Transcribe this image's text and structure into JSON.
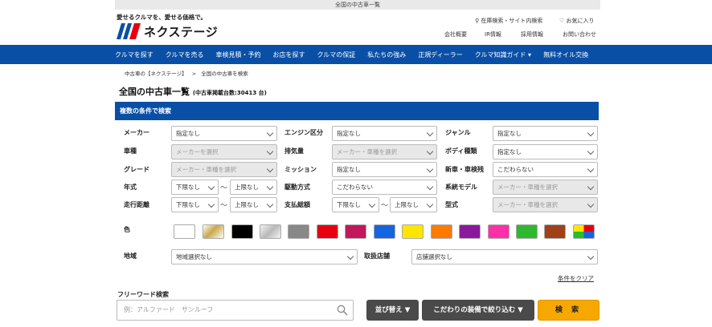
{
  "topbar": {
    "text": "全国の中古車一覧"
  },
  "header": {
    "tagline": "愛せるクルマを、愛せる価格で。",
    "logo_text": "ネクステージ",
    "links_top": [
      "在庫検索・サイト内検索",
      "お気に入り"
    ],
    "links_bottom": [
      "会社概要",
      "IR情報",
      "採用情報",
      "お問い合わせ"
    ]
  },
  "nav": {
    "items": [
      "クルマを探す",
      "クルマを売る",
      "車検見積・予約",
      "お店を探す",
      "クルマの保証",
      "私たちの強み",
      "正規ディーラー",
      "クルマ知識ガイド ▾",
      "無料オイル交換"
    ]
  },
  "breadcrumb": {
    "home": "中古車の【ネクステージ】",
    "sep": ">",
    "current": "全国の中古車を検索"
  },
  "page": {
    "title": "全国の中古車一覧",
    "count": "(中古車掲載台数:30413 台)"
  },
  "search": {
    "section_title": "複数の条件で検索",
    "fields": {
      "maker": {
        "label": "メーカー",
        "value": "指定なし"
      },
      "engine": {
        "label": "エンジン区分",
        "value": "指定なし"
      },
      "genre": {
        "label": "ジャンル",
        "value": "指定なし"
      },
      "model": {
        "label": "車種",
        "value": "メーカーを選択"
      },
      "displacement": {
        "label": "排気量",
        "value": "メーカー・車種を選択"
      },
      "body": {
        "label": "ボディ種類",
        "value": "指定なし"
      },
      "grade": {
        "label": "グレード",
        "value": "メーカー・車種を選択"
      },
      "mission": {
        "label": "ミッション",
        "value": "指定なし"
      },
      "newused": {
        "label": "新車・車検残",
        "value": "こだわらない"
      },
      "year": {
        "label": "年式",
        "min": "下限なし",
        "max": "上限なし"
      },
      "drive": {
        "label": "駆動方式",
        "value": "こだわらない"
      },
      "series": {
        "label": "系統モデル",
        "value": "メーカー・車種を選択"
      },
      "mileage": {
        "label": "走行距離",
        "min": "下限なし",
        "max": "上限なし"
      },
      "total": {
        "label": "支払総額",
        "min": "下限なし",
        "max": "上限なし"
      },
      "type": {
        "label": "型式",
        "value": "メーカー・車種を選択"
      }
    },
    "tilde": "〜",
    "color_label": "色",
    "colors": [
      "#ffffff",
      "gold",
      "#000000",
      "silver",
      "#888888",
      "#e60012",
      "#c2185b",
      "#1565e0",
      "#ffe500",
      "#ff7a00",
      "#8a1a9b",
      "#ff2fa8",
      "#2eb82e",
      "#a0401a",
      "multi"
    ],
    "region": {
      "label": "地域",
      "value": "地域選択なし"
    },
    "store": {
      "label": "取扱店舗",
      "value": "店舗選択なし"
    },
    "clear_label": "条件をクリア",
    "freeword": {
      "label": "フリーワード検索",
      "placeholder": "例：アルファード　サンルーフ"
    },
    "sort_button": "並び替え ▼",
    "equipment_button": "こだわりの装備で絞り込む ▼",
    "search_button": "検 索"
  },
  "colors": {
    "brand_blue": "#0a4fa6",
    "search_orange": "#f6a800"
  }
}
